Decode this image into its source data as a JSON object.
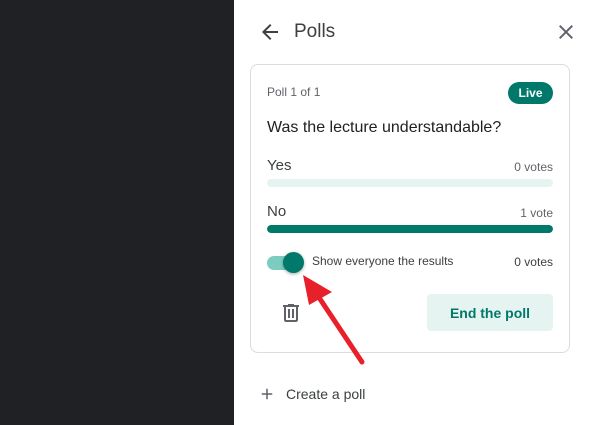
{
  "panel": {
    "title": "Polls",
    "back_icon": "arrow-back-icon",
    "close_icon": "close-icon"
  },
  "poll": {
    "count_text": "Poll 1 of 1",
    "status_badge": "Live",
    "question": "Was the lecture understandable?",
    "options": [
      {
        "label": "Yes",
        "votes_text": "0 votes",
        "fill_fraction": 0.0
      },
      {
        "label": "No",
        "votes_text": "1 vote",
        "fill_fraction": 1.0
      }
    ],
    "show_results_label": "Show everyone the results",
    "show_results_enabled": true,
    "total_votes_text": "0 votes",
    "end_button_label": "End the poll",
    "delete_icon": "trash-icon"
  },
  "footer": {
    "create_label": "Create a poll",
    "create_icon": "plus-icon"
  },
  "colors": {
    "accent": "#00796b",
    "accent_light": "#e6f4f1",
    "toggle_track": "#7ccdc0",
    "annotation_arrow": "#e8202a",
    "sidebar_dark": "#202124"
  }
}
